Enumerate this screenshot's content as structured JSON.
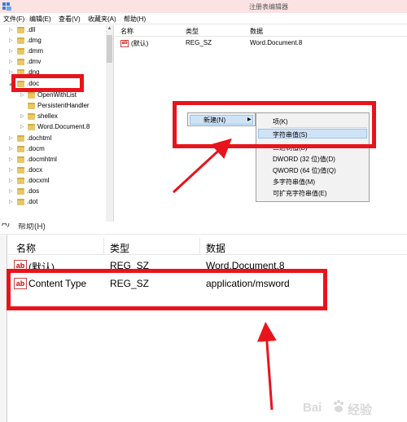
{
  "top": {
    "window_title": "注册表编辑器",
    "menu": [
      "文件(F)",
      "编辑(E)",
      "查看(V)",
      "收藏夹(A)",
      "帮助(H)"
    ],
    "tree": [
      {
        "label": ".dll",
        "indent": 0
      },
      {
        "label": ".dmg",
        "indent": 0
      },
      {
        "label": ".dmm",
        "indent": 0
      },
      {
        "label": ".dmv",
        "indent": 0
      },
      {
        "label": ".dng",
        "indent": 0
      },
      {
        "label": ".doc",
        "indent": 0
      },
      {
        "label": "OpenWithList",
        "indent": 1
      },
      {
        "label": "PersistentHandler",
        "indent": 1
      },
      {
        "label": "shellex",
        "indent": 1
      },
      {
        "label": "Word.Document.8",
        "indent": 1
      },
      {
        "label": ".dochtml",
        "indent": 0
      },
      {
        "label": ".docm",
        "indent": 0
      },
      {
        "label": ".docmhtml",
        "indent": 0
      },
      {
        "label": ".docx",
        "indent": 0
      },
      {
        "label": ".docxml",
        "indent": 0
      },
      {
        "label": ".dos",
        "indent": 0
      },
      {
        "label": ".dot",
        "indent": 0
      }
    ],
    "columns": {
      "name": "名称",
      "type": "类型",
      "data": "数据"
    },
    "rows": [
      {
        "icon": "ab",
        "name": "(默认)",
        "type": "REG_SZ",
        "data": "Word.Document.8"
      }
    ],
    "context_menu": {
      "label": "新建(N)"
    },
    "submenu": [
      "项(K)",
      "字符串值(S)",
      "二进制值(B)",
      "DWORD (32 位)值(D)",
      "QWORD (64 位)值(Q)",
      "多字符串值(M)",
      "可扩充字符串值(E)"
    ]
  },
  "bottom": {
    "menu_fragments": [
      "A)",
      "帮助(H)"
    ],
    "columns": {
      "name": "名称",
      "type": "类型",
      "data": "数据"
    },
    "rows": [
      {
        "icon": "ab",
        "name": "(默认)",
        "type": "REG_SZ",
        "data": "Word.Document.8"
      },
      {
        "icon": "ab",
        "name": "Content Type",
        "type": "REG_SZ",
        "data": "application/msword"
      }
    ]
  },
  "watermark": {
    "text_b": "Bai",
    "text_i": "经验",
    "text_c": ""
  },
  "colors": {
    "highlight_box": "#e8141b",
    "title_bar": "#fbe3e3",
    "menu_hover": "#cfe3f7"
  }
}
